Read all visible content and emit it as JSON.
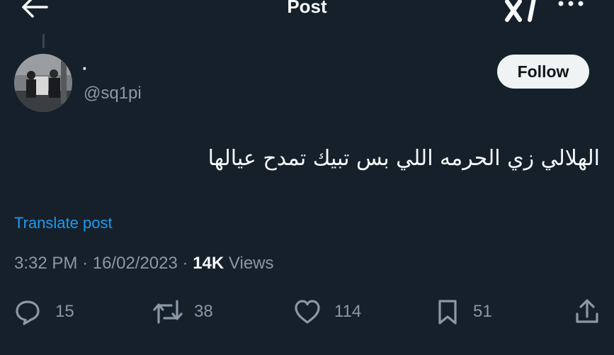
{
  "header": {
    "title": "Post"
  },
  "post": {
    "display_name": "·",
    "handle": "@sq1pi",
    "follow_label": "Follow",
    "text": "الهلالي زي الحرمه اللي بس تبيك تمدح عيالها",
    "translate_label": "Translate post",
    "time": "3:32 PM",
    "date": "16/02/2023",
    "views_count": "14K",
    "views_label": "Views",
    "sep": "·"
  },
  "actions": {
    "replies": "15",
    "reposts": "38",
    "likes": "114",
    "bookmarks": "51"
  },
  "colors": {
    "background": "#15202b",
    "accent": "#1d9bf0",
    "secondary_text": "#8b98a5"
  },
  "icons": [
    "back-arrow-icon",
    "grok-icon",
    "more-icon",
    "reply-icon",
    "repost-icon",
    "like-icon",
    "bookmark-icon",
    "share-icon"
  ]
}
